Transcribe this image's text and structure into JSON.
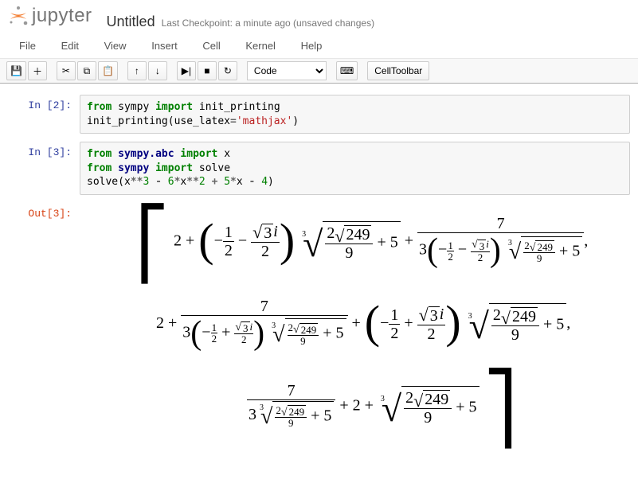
{
  "header": {
    "title": "Untitled",
    "checkpoint": "Last Checkpoint: a minute ago (unsaved changes)"
  },
  "menubar": [
    "File",
    "Edit",
    "View",
    "Insert",
    "Cell",
    "Kernel",
    "Help"
  ],
  "toolbar": {
    "celltype_selected": "Code",
    "celltoolbar_label": "CellToolbar"
  },
  "cells": [
    {
      "in_label": "In [2]:",
      "out_label": "",
      "code_tokens": [
        {
          "t": "from ",
          "c": "kw-green"
        },
        {
          "t": "sympy ",
          "c": ""
        },
        {
          "t": "import ",
          "c": "kw-green"
        },
        {
          "t": "init_printing",
          "c": ""
        },
        {
          "t": "\n",
          "c": ""
        },
        {
          "t": "init_printing(use_latex",
          "c": ""
        },
        {
          "t": "=",
          "c": "op"
        },
        {
          "t": "'mathjax'",
          "c": "str"
        },
        {
          "t": ")",
          "c": ""
        }
      ]
    },
    {
      "in_label": "In [3]:",
      "out_label": "Out[3]:",
      "code_tokens": [
        {
          "t": "from ",
          "c": "kw-green"
        },
        {
          "t": "sympy.abc ",
          "c": "kw-nav"
        },
        {
          "t": "import ",
          "c": "kw-green"
        },
        {
          "t": "x",
          "c": ""
        },
        {
          "t": "\n",
          "c": ""
        },
        {
          "t": "from ",
          "c": "kw-green"
        },
        {
          "t": "sympy ",
          "c": "kw-nav"
        },
        {
          "t": "import ",
          "c": "kw-green"
        },
        {
          "t": "solve",
          "c": ""
        },
        {
          "t": "\n",
          "c": ""
        },
        {
          "t": "solve(x",
          "c": ""
        },
        {
          "t": "**",
          "c": "op"
        },
        {
          "t": "3",
          "c": "num-code"
        },
        {
          "t": " ",
          "c": ""
        },
        {
          "t": "-",
          "c": "op"
        },
        {
          "t": " ",
          "c": ""
        },
        {
          "t": "6",
          "c": "num-code"
        },
        {
          "t": "*",
          "c": "op"
        },
        {
          "t": "x",
          "c": ""
        },
        {
          "t": "**",
          "c": "op"
        },
        {
          "t": "2",
          "c": "num-code"
        },
        {
          "t": " ",
          "c": ""
        },
        {
          "t": "+",
          "c": "op"
        },
        {
          "t": " ",
          "c": ""
        },
        {
          "t": "5",
          "c": "num-code"
        },
        {
          "t": "*",
          "c": "op"
        },
        {
          "t": "x ",
          "c": ""
        },
        {
          "t": "-",
          "c": "op"
        },
        {
          "t": " ",
          "c": ""
        },
        {
          "t": "4",
          "c": "num-code"
        },
        {
          "t": ")",
          "c": ""
        }
      ]
    }
  ],
  "math": {
    "a": "2",
    "b": "1",
    "c": "2",
    "d": "3",
    "e": "249",
    "f": "9",
    "g": "5",
    "h": "7",
    "i_": "3"
  }
}
